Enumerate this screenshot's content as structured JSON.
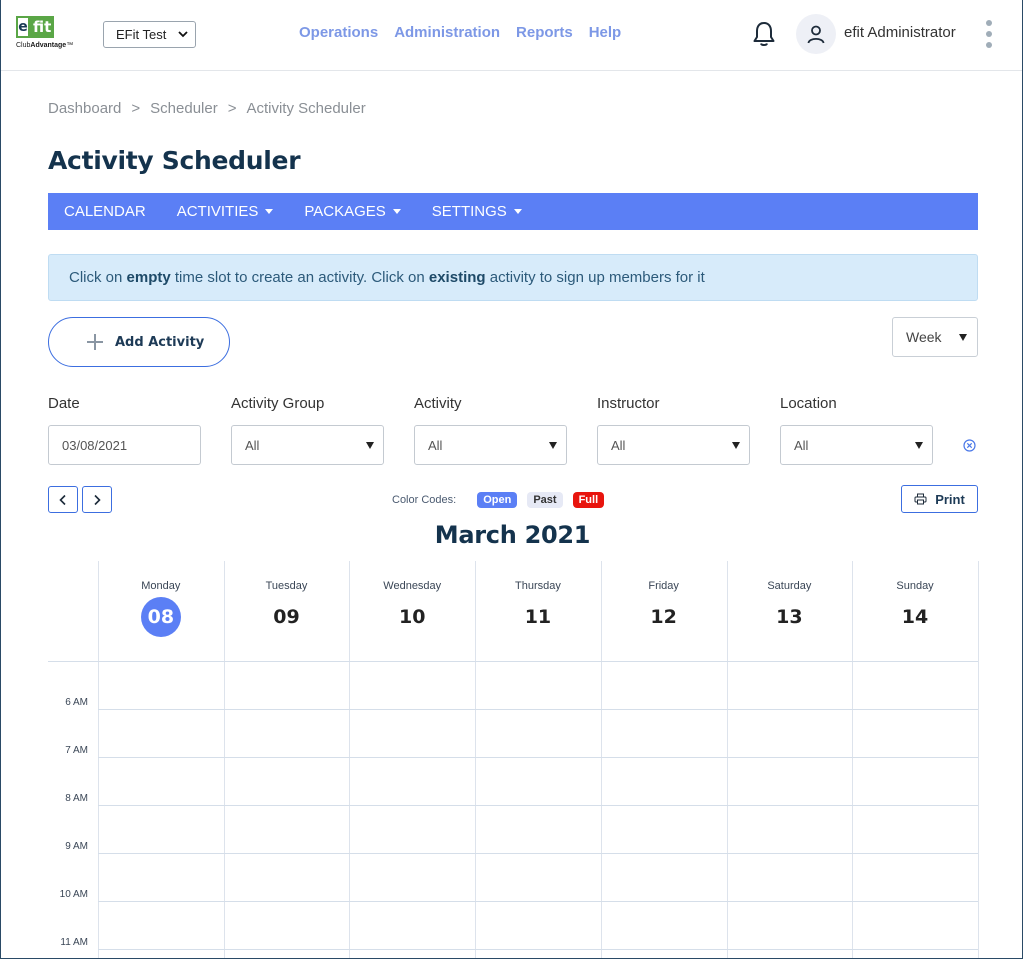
{
  "brand": {
    "logo_e": "e",
    "logo_fit": "fit",
    "logo_sub_prefix": "Club",
    "logo_sub_bold": "Advantage",
    "logo_tm": "™",
    "green": "#5aa646"
  },
  "club_select": {
    "value": "EFit Test"
  },
  "topnav": [
    {
      "label": "Operations"
    },
    {
      "label": "Administration"
    },
    {
      "label": "Reports"
    },
    {
      "label": "Help"
    }
  ],
  "user": {
    "name": "efit Administrator"
  },
  "breadcrumb": [
    {
      "label": "Dashboard"
    },
    {
      "label": ">"
    },
    {
      "label": "Scheduler"
    },
    {
      "label": ">"
    },
    {
      "label": "Activity Scheduler"
    }
  ],
  "page": {
    "title": "Activity Scheduler"
  },
  "subnav": [
    {
      "label": "CALENDAR",
      "dropdown": false
    },
    {
      "label": "ACTIVITIES",
      "dropdown": true
    },
    {
      "label": "PACKAGES",
      "dropdown": true
    },
    {
      "label": "SETTINGS",
      "dropdown": true
    }
  ],
  "info": {
    "t1": "Click on ",
    "b1": "empty",
    "t2": " time slot to create an activity. Click on ",
    "b2": "existing",
    "t3": " activity to sign up members for it"
  },
  "actions": {
    "add_label": "Add Activity",
    "view_value": "Week"
  },
  "filters": {
    "date_label": "Date",
    "date_value": "03/08/2021",
    "group_label": "Activity Group",
    "group_value": "All",
    "activity_label": "Activity",
    "activity_value": "All",
    "instructor_label": "Instructor",
    "instructor_value": "All",
    "location_label": "Location",
    "location_value": "All"
  },
  "legend": {
    "label": "Color Codes:",
    "open": "Open",
    "past": "Past",
    "full": "Full",
    "open_color": "#5b7ff5",
    "past_color": "#e6e9f5",
    "full_color": "#e8150e"
  },
  "print_label": "Print",
  "calendar": {
    "month_title": "March 2021",
    "days": [
      {
        "name": "Monday",
        "num": "08",
        "today": true
      },
      {
        "name": "Tuesday",
        "num": "09",
        "today": false
      },
      {
        "name": "Wednesday",
        "num": "10",
        "today": false
      },
      {
        "name": "Thursday",
        "num": "11",
        "today": false
      },
      {
        "name": "Friday",
        "num": "12",
        "today": false
      },
      {
        "name": "Saturday",
        "num": "13",
        "today": false
      },
      {
        "name": "Sunday",
        "num": "14",
        "today": false
      }
    ],
    "times": [
      "6 AM",
      "7 AM",
      "8 AM",
      "9 AM",
      "10 AM",
      "11 AM"
    ]
  },
  "colors": {
    "accent": "#5b7ff5",
    "title": "#14334d",
    "nav_link": "#7d98e6"
  }
}
